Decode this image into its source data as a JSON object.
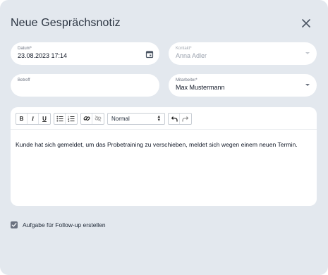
{
  "dialog": {
    "title": "Neue Gesprächsnotiz",
    "close_icon": "close-icon"
  },
  "fields": {
    "datum": {
      "label": "Datum*",
      "value": "23.08.2023 17:14",
      "icon": "calendar-icon"
    },
    "kontakt": {
      "label": "Kontakt*",
      "value": "Anna Adler",
      "disabled": true
    },
    "betreff": {
      "label": "Betreff",
      "value": ""
    },
    "mitarbeiter": {
      "label": "Mitarbeiter*",
      "value": "Max Mustermann"
    }
  },
  "editor": {
    "toolbar": {
      "bold": "B",
      "italic": "I",
      "underline": "U",
      "format_select": "Normal",
      "icons": [
        "bullet-list-icon",
        "numbered-list-icon",
        "link-icon",
        "unlink-icon",
        "undo-icon",
        "redo-icon"
      ]
    },
    "content": "Kunde hat sich gemeldet, um das Probetraining zu verschieben, meldet sich wegen einem neuen Termin."
  },
  "followup": {
    "label": "Aufgabe für Follow-up erstellen",
    "checked": true
  },
  "colors": {
    "dialog_bg": "#e3e8ee",
    "field_bg": "#ffffff",
    "checkbox": "#6b7280"
  }
}
